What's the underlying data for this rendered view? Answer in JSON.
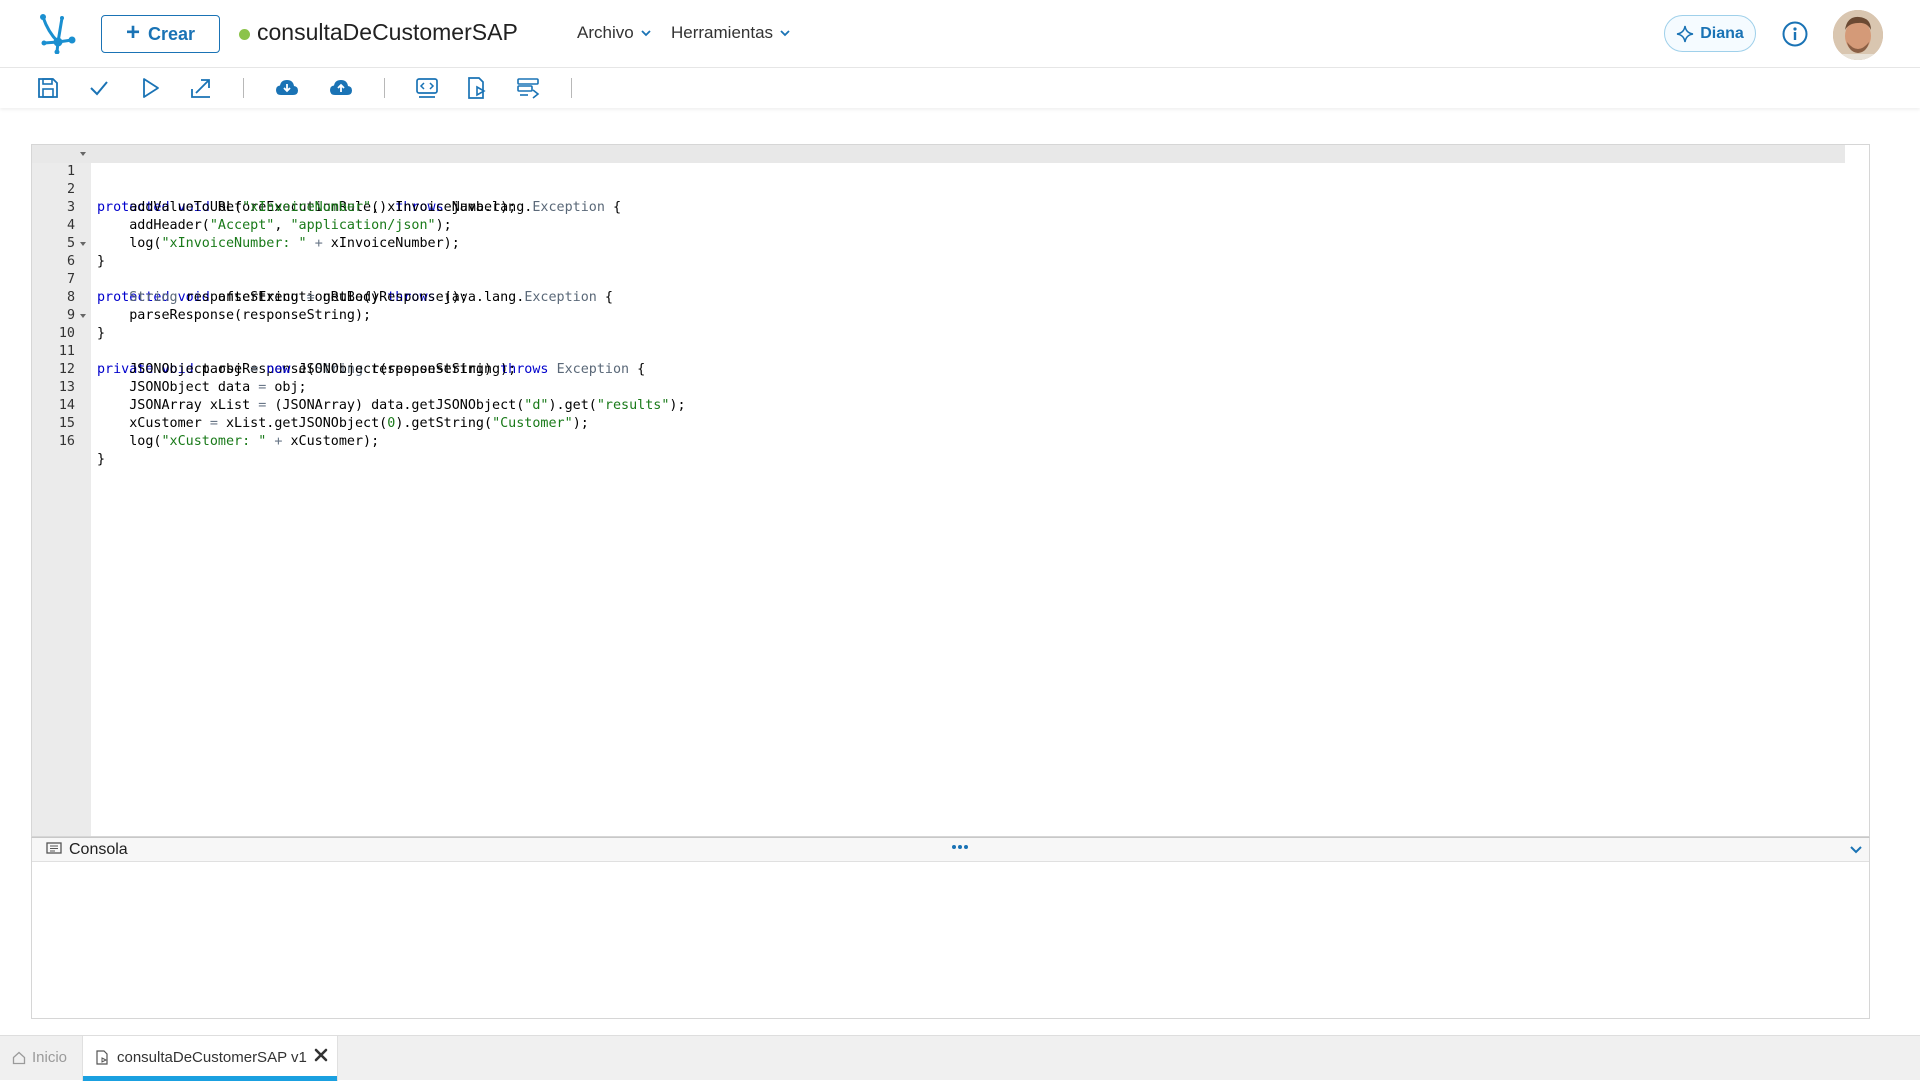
{
  "header": {
    "create_label": "Crear",
    "doc_title": "consultaDeCustomerSAP",
    "status_color": "#8bc34a",
    "menus": [
      {
        "label": "Archivo"
      },
      {
        "label": "Herramientas"
      }
    ],
    "assistant_label": "Diana",
    "accent_color": "#1a73b5"
  },
  "toolbar": {
    "icons": [
      "save-icon",
      "check-icon",
      "play-icon",
      "export-icon",
      "cloud-download-icon",
      "cloud-upload-icon",
      "code-view-icon",
      "document-properties-icon",
      "list-settings-icon"
    ]
  },
  "editor": {
    "line_numbers": [
      "1",
      "2",
      "3",
      "4",
      "5",
      "6",
      "7",
      "8",
      "9",
      "10",
      "11",
      "12",
      "13",
      "14",
      "15",
      "16"
    ]
  },
  "console": {
    "label": "Consola"
  },
  "tabs": {
    "home": "Inicio",
    "active": "consultaDeCustomerSAP v1"
  }
}
